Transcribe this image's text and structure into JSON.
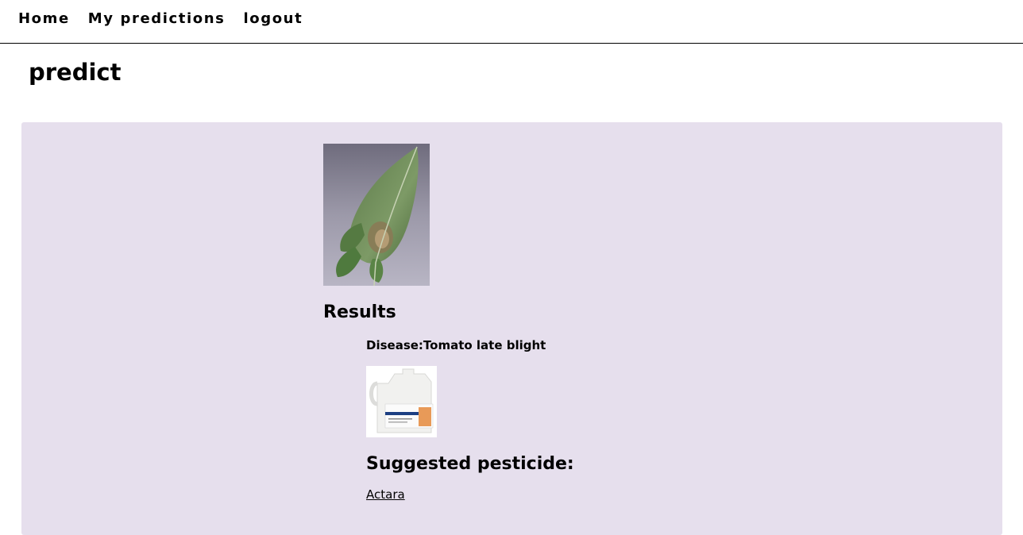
{
  "nav": {
    "items": [
      {
        "label": "Home"
      },
      {
        "label": "My predictions"
      },
      {
        "label": "logout"
      }
    ]
  },
  "page": {
    "title": "predict"
  },
  "results": {
    "heading": "Results",
    "disease_prefix": "Disease:",
    "disease_name": "Tomato late blight",
    "pesticide_heading": "Suggested pesticide:",
    "pesticide_name": "Actara"
  },
  "colors": {
    "panel_background": "#e6dfed",
    "nav_border": "#000000"
  }
}
